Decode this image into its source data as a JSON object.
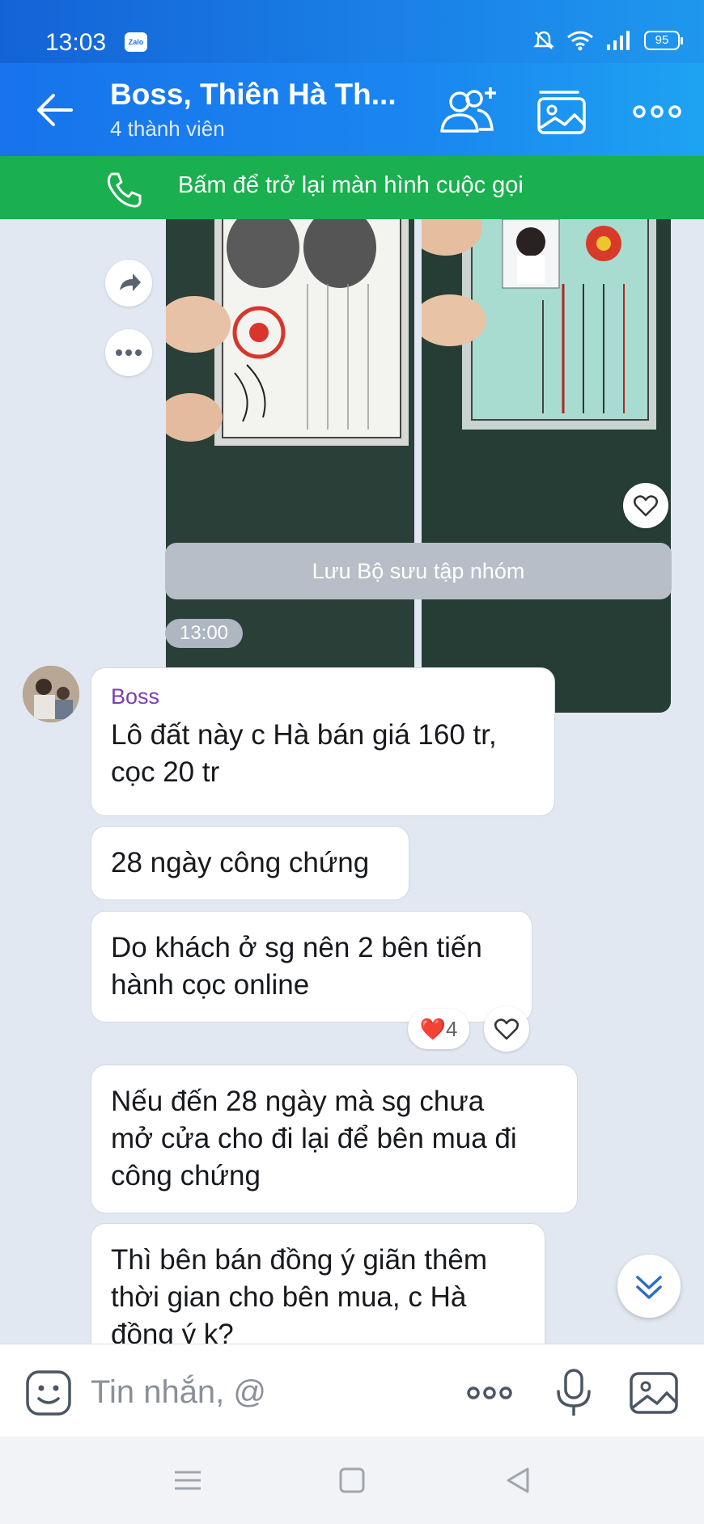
{
  "status_bar": {
    "time": "13:03",
    "app_badge": "Zalo",
    "battery": "95"
  },
  "header": {
    "title": "Boss, Thiên Hà Th...",
    "subtitle": "4 thành viên",
    "icons": [
      "back-arrow-icon",
      "add-member-icon",
      "gallery-icon",
      "more-icon"
    ]
  },
  "call_banner": {
    "text": "Bấm để trở lại màn hình cuộc gọi"
  },
  "save_collection": {
    "label": "Lưu Bộ sưu tập nhóm"
  },
  "time_divider": "13:00",
  "messages": [
    {
      "sender": "Boss",
      "text_lines": [
        "Lô đất này c Hà bán giá 160 tr,",
        "cọc 20 tr"
      ]
    },
    {
      "text": "28 ngày công chứng"
    },
    {
      "text_lines": [
        "Do khách ở sg nên 2 bên tiến",
        "hành cọc online"
      ],
      "reaction": {
        "emoji": "❤️",
        "count": "4"
      }
    },
    {
      "text_lines": [
        "Nếu đến 28 ngày mà sg chưa",
        "mở cửa cho đi lại để bên mua đi",
        "công chứng"
      ]
    },
    {
      "text_lines": [
        "Thì bên bán đồng ý giãn thêm",
        "thời gian cho bên mua, c Hà",
        "đồng ý k?"
      ]
    }
  ],
  "input": {
    "placeholder": "Tin nhắn, @"
  },
  "nav": [
    "menu-icon",
    "home-square-icon",
    "back-triangle-icon"
  ],
  "colors": {
    "header": "#1a86f0",
    "call_banner": "#1aaf4f",
    "background": "#e2e8f1",
    "sender": "#7a3db8"
  }
}
